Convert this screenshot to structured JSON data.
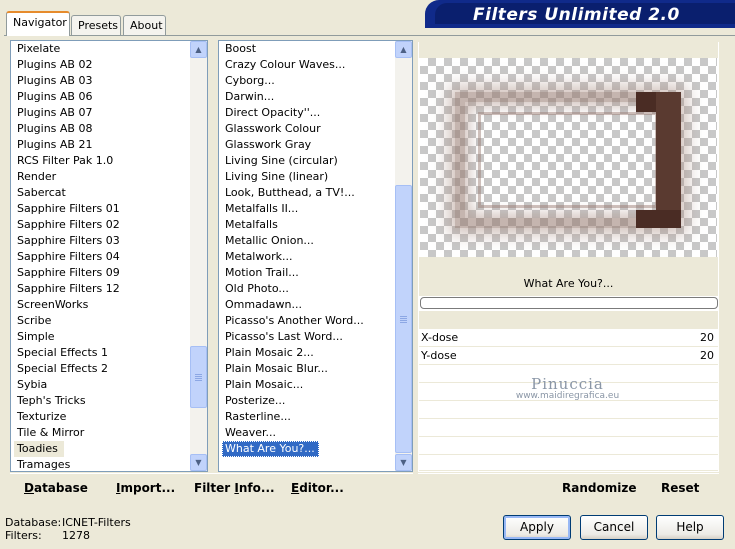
{
  "tabs": [
    "Navigator",
    "Presets",
    "About"
  ],
  "title": "Filters Unlimited 2.0",
  "categories": {
    "items": [
      "Pixelate",
      "Plugins AB 02",
      "Plugins AB 03",
      "Plugins AB 06",
      "Plugins AB 07",
      "Plugins AB 08",
      "Plugins AB 21",
      "RCS Filter Pak 1.0",
      "Render",
      "Sabercat",
      "Sapphire Filters 01",
      "Sapphire Filters 02",
      "Sapphire Filters 03",
      "Sapphire Filters 04",
      "Sapphire Filters 09",
      "Sapphire Filters 12",
      "ScreenWorks",
      "Scribe",
      "Simple",
      "Special Effects 1",
      "Special Effects 2",
      "Sybia",
      "Teph's Tricks",
      "Texturize",
      "Tile & Mirror",
      "Toadies",
      "Tramages"
    ],
    "selected": "Toadies"
  },
  "filters": {
    "items": [
      "Boost",
      "Crazy Colour Waves...",
      "Cyborg...",
      "Darwin...",
      "Direct Opacity''...",
      "Glasswork Colour",
      "Glasswork Gray",
      "Living Sine (circular)",
      "Living Sine (linear)",
      "Look, Butthead, a TV!...",
      "Metalfalls II...",
      "Metalfalls",
      "Metallic Onion...",
      "Metalwork...",
      "Motion Trail...",
      "Old Photo...",
      "Ommadawn...",
      "Picasso's Another Word...",
      "Picasso's Last Word...",
      "Plain Mosaic 2...",
      "Plain Mosaic Blur...",
      "Plain Mosaic...",
      "Posterize...",
      "Rasterline...",
      "Weaver...",
      "What Are You?..."
    ],
    "selected": "What Are You?..."
  },
  "preview": {
    "filter_name": "What Are You?...",
    "params": [
      {
        "name": "X-dose",
        "value": "20"
      },
      {
        "name": "Y-dose",
        "value": "20"
      }
    ],
    "watermark_name": "Pinuccia",
    "watermark_url": "www.maidiregrafica.eu"
  },
  "toolbar": {
    "database": "Database",
    "import": "Import...",
    "filter_info": "Filter Info...",
    "editor": "Editor...",
    "randomize": "Randomize",
    "reset": "Reset"
  },
  "status": {
    "database_label": "Database:",
    "database_value": "ICNET-Filters",
    "filters_label": "Filters:",
    "filters_value": "1278"
  },
  "buttons": {
    "apply": "Apply",
    "cancel": "Cancel",
    "help": "Help"
  },
  "colors": {
    "selection": "#316ac5",
    "banner": "#102a8a",
    "frame_dark": "#4a2c24"
  }
}
